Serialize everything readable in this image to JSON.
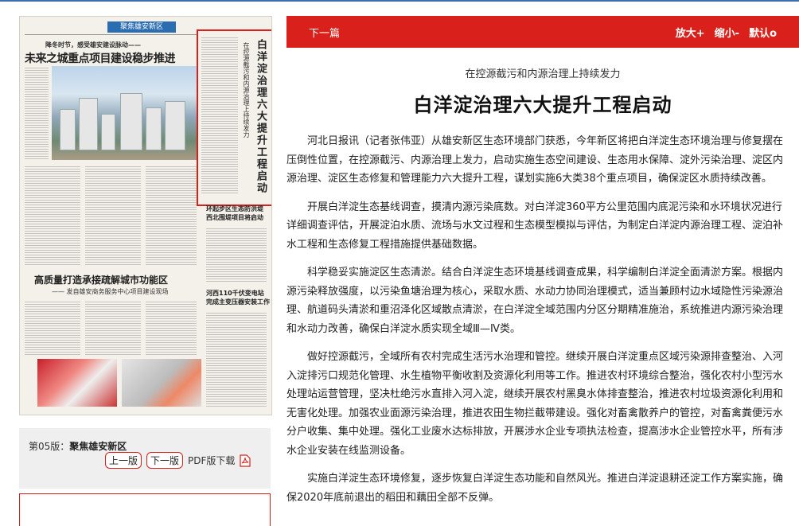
{
  "newspaper": {
    "section_tag": "聚焦雄安新区",
    "kicker": "降冬时节，感受雄安建设脉动——",
    "headline": "未来之城重点项目建设稳步推进",
    "highlight_title": "白洋淀治理六大提升工程启动",
    "highlight_subtitle": "在控源截污和内源治理上持续发力",
    "side_title1": "环起步区生态防洪堤\n西北围堤项目将启动",
    "side_title2": "河西110千伏变电站\n完成主变压器安装工作",
    "h2": "高质量打造承接疏解城市功能区",
    "h2_sub": "—— 发自雄安商务服务中心项目建设现场"
  },
  "page_info": {
    "edition_prefix": "第05版：",
    "edition_name": "聚焦雄安新区",
    "prev_page": "上一版",
    "next_page": "下一版",
    "pdf_download": "PDF版下载"
  },
  "toolbar": {
    "next_article": "下一篇",
    "zoom_in": "放大+",
    "zoom_out": "缩小-",
    "default": "默认o"
  },
  "article": {
    "kicker": "在控源截污和内源治理上持续发力",
    "title": "白洋淀治理六大提升工程启动",
    "paragraphs": [
      "河北日报讯（记者张伟亚）从雄安新区生态环境部门获悉，今年新区将把白洋淀生态环境治理与修复摆在压倒性位置，在控源截污、内源治理上发力，启动实施生态空间建设、生态用水保障、淀外污染治理、淀区内源治理、淀区生态修复和管理能力六大提升工程，谋划实施6大类38个重点项目，确保淀区水质持续改善。",
      "开展白洋淀生态基线调查，摸清内源污染底数。对白洋淀360平方公里范围内底泥污染和水环境状况进行详细调查评估，开展淀泊水质、流场与水文过程和生态模型模拟与评估，为制定白洋淀内源治理工程、淀泊补水工程和生态修复工程措施提供基础数据。",
      "科学稳妥实施淀区生态清淤。结合白洋淀生态环境基线调查成果，科学编制白洋淀全面清淤方案。根据内源污染释放强度，以污染鱼塘治理为核心，采取水质、水动力协同治理模式，适当兼顾村边水域隐性污染源治理、航道码头清淤和重沼泽化区域散点清淤，在白洋淀全域范围内分区分期精准施治，系统推进内源污染治理和水动力改善，确保白洋淀水质实现全域Ⅲ—Ⅳ类。",
      "做好控源截污，全域所有农村完成生活污水治理和管控。继续开展白洋淀重点区域污染源排查整治、入河入淀排污口规范化管理、水生植物平衡收割及资源化利用等工作。推进农村环境综合整治，强化农村小型污水处理站运营管理，坚决杜绝污水直排入河入淀，继续开展农村黑臭水体排查整治，推进农村垃圾资源化利用和无害化处理。加强农业面源污染治理，推进农田生物拦截带建设。强化对畜禽散养户的管控，对畜禽粪便污水分户收集、集中处理。强化工业废水达标排放，开展涉水企业专项执法检查，提高涉水企业管控水平，所有涉水企业安装在线监测设备。",
      "实施白洋淀生态环境修复，逐步恢复白洋淀生态功能和自然风光。推进白洋淀退耕还淀工作方案实施，确保2020年底前退出的稻田和藕田全部不反弹。"
    ]
  },
  "colors": {
    "accent_red": "#d9201a",
    "top_line_blue": "#3d6fb7"
  }
}
